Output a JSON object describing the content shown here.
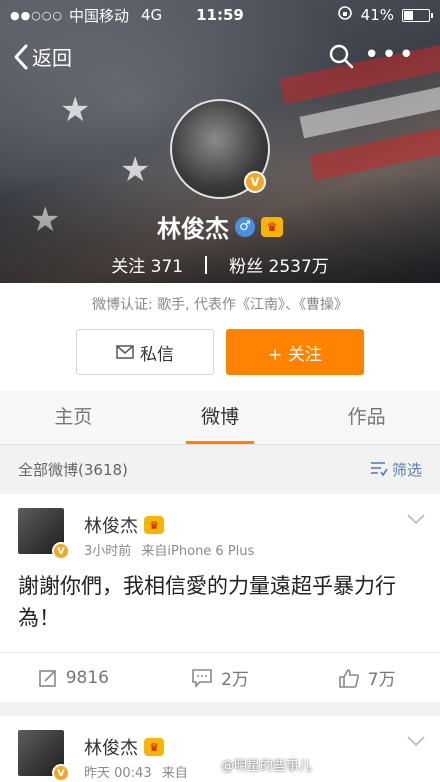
{
  "status_bar": {
    "signal": "●●○○○",
    "carrier": "中国移动",
    "network": "4G",
    "time": "11:59",
    "battery_percent": "41%",
    "battery_level": 0.41
  },
  "nav": {
    "back_label": "返回"
  },
  "profile": {
    "name": "林俊杰",
    "following_label": "关注",
    "following_count": "371",
    "followers_label": "粉丝",
    "followers_count": "2537万",
    "verification": "微博认证: 歌手, 代表作《江南》、《曹操》",
    "badge": "V"
  },
  "actions": {
    "message_label": "私信",
    "follow_label": "+ 关注"
  },
  "tabs": [
    {
      "label": "主页"
    },
    {
      "label": "微博"
    },
    {
      "label": "作品"
    }
  ],
  "feed": {
    "header": "全部微博(3618)",
    "filter_label": "筛选"
  },
  "posts": [
    {
      "author": "林俊杰",
      "time": "3小时前",
      "source": "来自iPhone 6 Plus",
      "text": "謝謝你們，我相信愛的力量遠超乎暴力行為！",
      "reposts": "9816",
      "comments": "2万",
      "likes": "7万"
    },
    {
      "author": "林俊杰",
      "time": "昨天 00:43",
      "source": "来自",
      "watermark": "@明星的些事儿"
    }
  ],
  "colors": {
    "accent": "#ff8200",
    "link": "#5b7fb6",
    "verified": "#f5a623"
  }
}
